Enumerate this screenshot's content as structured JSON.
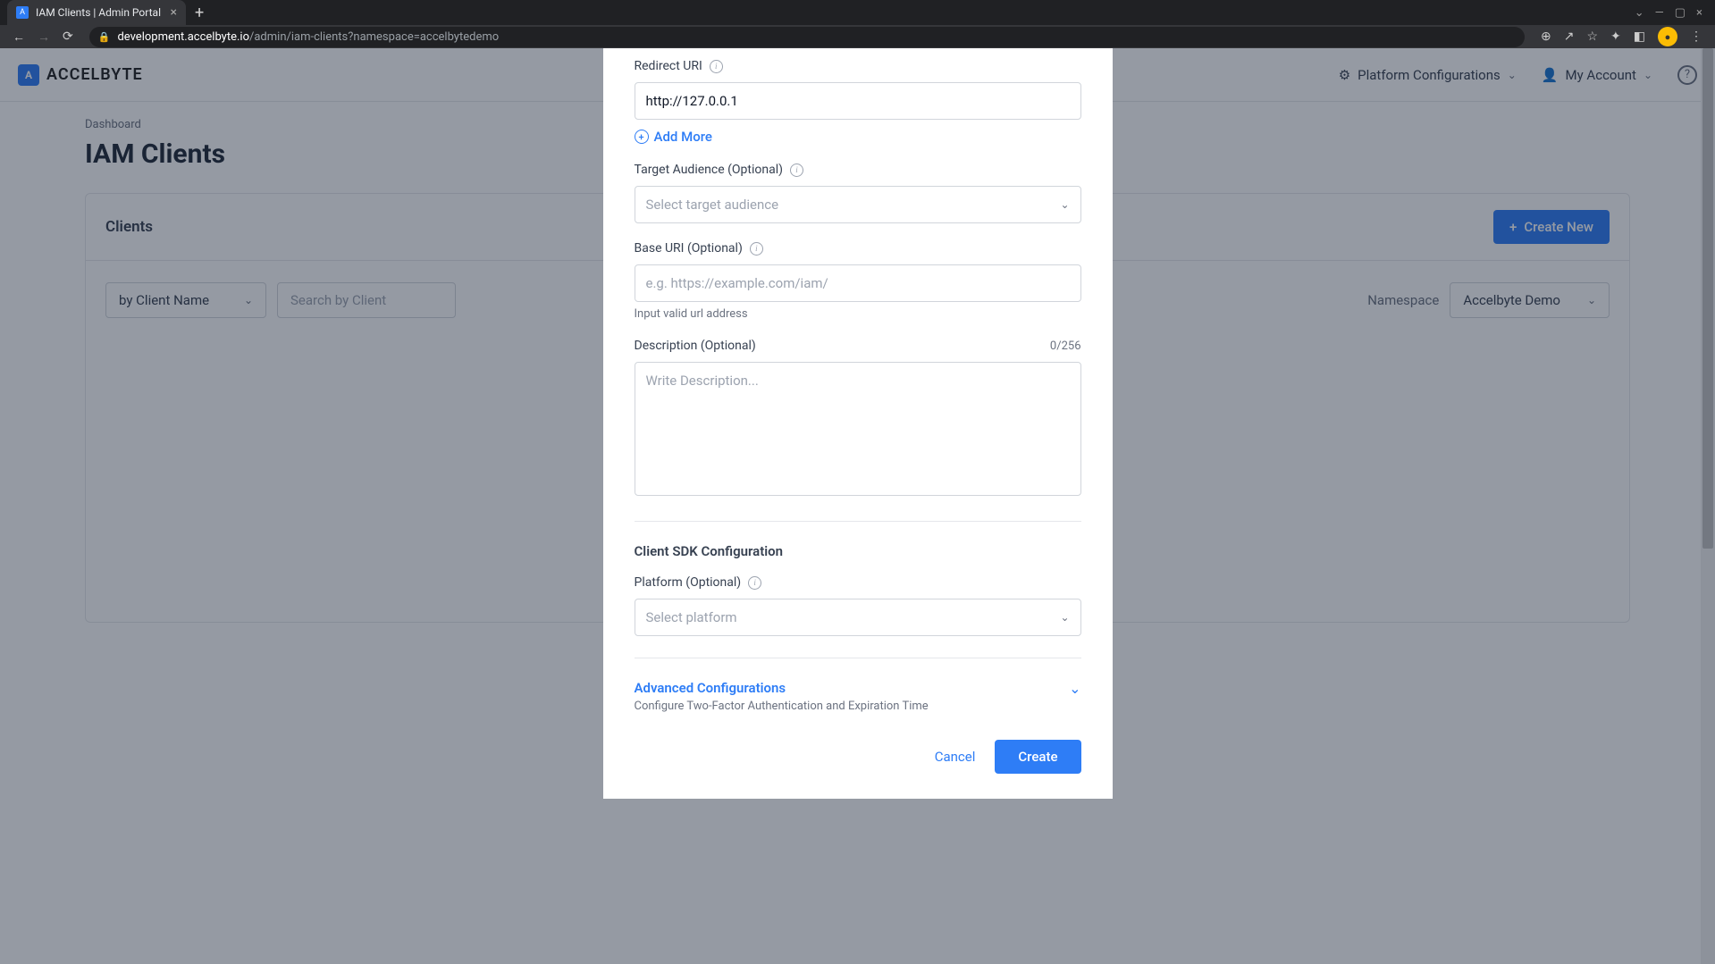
{
  "browser": {
    "tab_title": "IAM Clients | Admin Portal",
    "url_domain": "development.accelbyte.io",
    "url_path": "/admin/iam-clients?namespace=accelbytedemo"
  },
  "header": {
    "logo_text": "ACCELBYTE",
    "platform_config": "Platform Configurations",
    "my_account": "My Account"
  },
  "page": {
    "breadcrumb": "Dashboard",
    "title": "IAM Clients"
  },
  "panel": {
    "title": "Clients",
    "create_new": "Create New",
    "search_by": "by Client Name",
    "search_placeholder": "Search by Client",
    "namespace_label": "Namespace",
    "namespace_value": "Accelbyte Demo"
  },
  "modal": {
    "redirect_uri_label": "Redirect URI",
    "redirect_uri_value": "http://127.0.0.1",
    "add_more": "Add More",
    "target_audience_label": "Target Audience (Optional)",
    "target_audience_placeholder": "Select target audience",
    "base_uri_label": "Base URI (Optional)",
    "base_uri_placeholder": "e.g. https://example.com/iam/",
    "base_uri_helper": "Input valid url address",
    "description_label": "Description (Optional)",
    "description_counter": "0/256",
    "description_placeholder": "Write Description...",
    "sdk_section_title": "Client SDK Configuration",
    "platform_label": "Platform (Optional)",
    "platform_placeholder": "Select platform",
    "advanced_title": "Advanced Configurations",
    "advanced_subtitle": "Configure Two-Factor Authentication and Expiration Time",
    "cancel": "Cancel",
    "create": "Create"
  }
}
